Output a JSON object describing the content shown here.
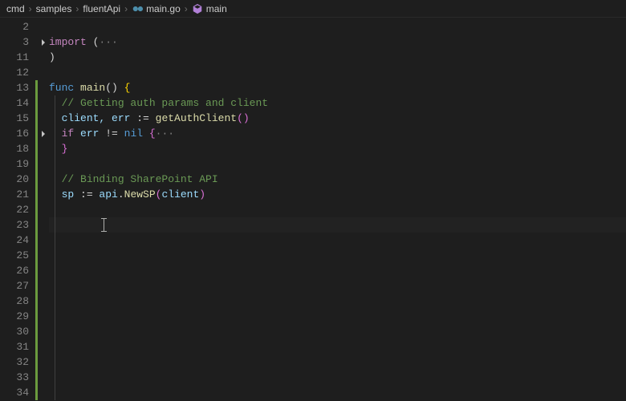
{
  "breadcrumb": {
    "items": [
      "cmd",
      "samples",
      "fluentApi",
      "main.go",
      "main"
    ]
  },
  "lineNumbers": [
    "2",
    "3",
    "11",
    "12",
    "13",
    "14",
    "15",
    "16",
    "18",
    "19",
    "20",
    "21",
    "22",
    "23",
    "24",
    "25",
    "26",
    "27",
    "28",
    "29",
    "30",
    "31",
    "32",
    "33",
    "34"
  ],
  "code": {
    "l2": "",
    "l3_import": "import",
    "l3_open": " (",
    "l3_dots": "···",
    "l11": ")",
    "l13_func": "func",
    "l13_main": "main",
    "l13_sig": "() ",
    "l13_brace": "{",
    "l14": "// Getting auth params and client",
    "l15_lhs": "client, err ",
    "l15_op": ":= ",
    "l15_fn": "getAuthClient",
    "l15_par": "()",
    "l16_if": "if",
    "l16_expr": " err ",
    "l16_neq": "!=",
    "l16_nil": " nil ",
    "l16_brace": "{",
    "l16_dots": "···",
    "l18": "}",
    "l20": "// Binding SharePoint API",
    "l21_lhs": "sp ",
    "l21_op": ":= ",
    "l21_pkg": "api",
    "l21_dot": ".",
    "l21_fn": "NewSP",
    "l21_po": "(",
    "l21_arg": "client",
    "l21_pc": ")"
  }
}
